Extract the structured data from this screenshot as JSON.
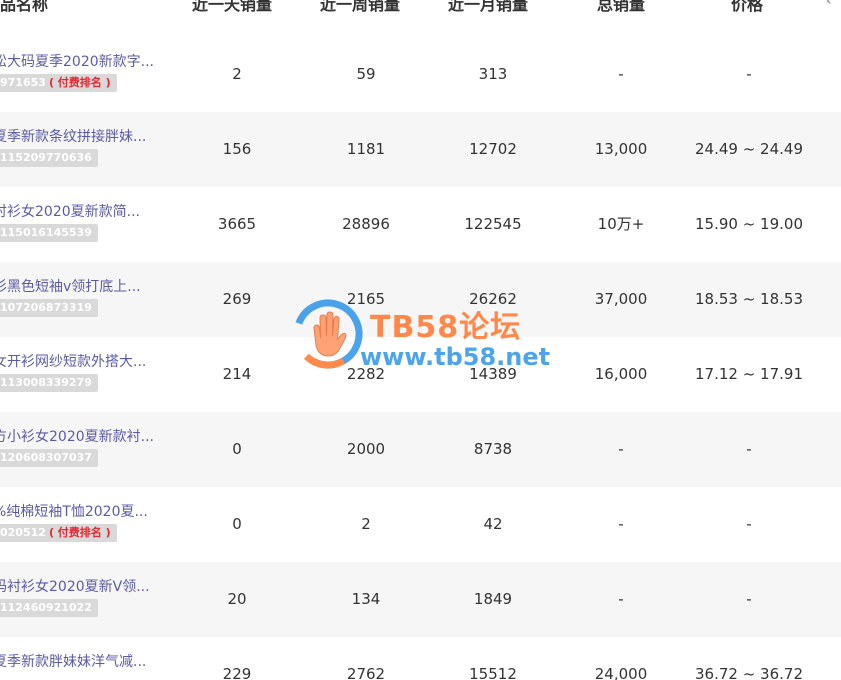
{
  "table": {
    "headers": {
      "name": "品名称",
      "day_sales": "近一天销量",
      "week_sales": "近一周销量",
      "month_sales": "近一月销量",
      "total_sales": "总销量",
      "price": "价格"
    },
    "rows": [
      {
        "name": "松大码夏季2020新款字...",
        "tag_id": "971653",
        "paid_label": "( 付费排名 )",
        "day": "2",
        "week": "59",
        "month": "313",
        "total": "-",
        "price": "-"
      },
      {
        "name": "夏季新款条纹拼接胖妹...",
        "tag_id": "115209770636",
        "paid_label": "",
        "day": "156",
        "week": "1181",
        "month": "12702",
        "total": "13,000",
        "price": "24.49 ~ 24.49"
      },
      {
        "name": "衬衫女2020夏新款简...",
        "tag_id": "115016145539",
        "paid_label": "",
        "day": "3665",
        "week": "28896",
        "month": "122545",
        "total": "10万+",
        "price": "15.90 ~ 19.00"
      },
      {
        "name": "衫黑色短袖v领打底上...",
        "tag_id": "107206873319",
        "paid_label": "",
        "day": "269",
        "week": "2165",
        "month": "26262",
        "total": "37,000",
        "price": "18.53 ~ 18.53"
      },
      {
        "name": "女开衫网纱短款外搭大...",
        "tag_id": "113008339279",
        "paid_label": "",
        "day": "214",
        "week": "2282",
        "month": "14389",
        "total": "16,000",
        "price": "17.12 ~ 17.91"
      },
      {
        "name": "方小衫女2020夏新款衬...",
        "tag_id": "120608307037",
        "paid_label": "",
        "day": "0",
        "week": "2000",
        "month": "8738",
        "total": "-",
        "price": "-"
      },
      {
        "name": "%纯棉短袖T恤2020夏...",
        "tag_id": "020512",
        "paid_label": "( 付费排名 )",
        "day": "0",
        "week": "2",
        "month": "42",
        "total": "-",
        "price": "-"
      },
      {
        "name": "码衬衫女2020夏新V领...",
        "tag_id": "112460921022",
        "paid_label": "",
        "day": "20",
        "week": "134",
        "month": "1849",
        "total": "-",
        "price": "-"
      },
      {
        "name": "夏季新款胖妹妹洋气减...",
        "tag_id": "",
        "paid_label": "",
        "day": "229",
        "week": "2762",
        "month": "15512",
        "total": "24,000",
        "price": "36.72 ~ 36.72"
      }
    ]
  },
  "watermark": {
    "title": "TB58论坛",
    "url": "www.tb58.net"
  },
  "colors": {
    "link": "#5a5aa8",
    "paid": "#e8262f",
    "tag_bg": "#d9d9d9",
    "row_alt": "#f6f6f6",
    "wm_orange": "#ff6a1a",
    "wm_blue": "#1a8be8"
  },
  "icons": {
    "sort": "chevron-icon",
    "logo": "hand-logo-icon"
  }
}
